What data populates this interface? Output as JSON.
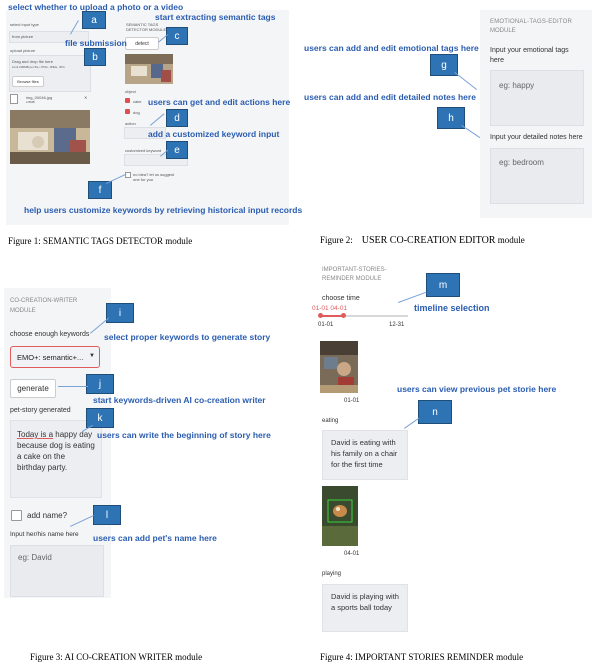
{
  "fig1": {
    "caption": "Figure 1: SEMANTIC TAGS DETECTOR module",
    "select_input_type_label": "select input type",
    "input_type_value": "from picture",
    "upload_picture_label": "upload picture",
    "drop_text": "Drag and drop file here",
    "limit_text": "Limit 200MB per file • PNG, JPEG, JPG",
    "browse_label": "Browse files",
    "file_name": "img_00046.jpg",
    "file_size": "2.8MB",
    "module_title": "SEMANTIC TAGS DETECTOR MODULE",
    "detect_button": "detect",
    "object_label": "object",
    "tag1": "cake",
    "tag2": "dog",
    "action_label": "action",
    "custom_keyword_label": "customized keyword",
    "no_idea_text": "no idea? let us suggest one for you",
    "annotations": {
      "a_text": "select whether to upload a photo or a video",
      "b_text": "file submission",
      "c_text": "start extracting semantic tags",
      "d_text": "users can get and edit actions here",
      "e_text": "add a customized keyword input",
      "f_text": "help users customize keywords by retrieving historical input records"
    },
    "letters": {
      "a": "a",
      "b": "b",
      "c": "c",
      "d": "d",
      "e": "e",
      "f": "f"
    }
  },
  "fig2": {
    "caption_prefix": "Figure 2:",
    "caption_main": "USER CO-CREATION EDITOR",
    "caption_suffix": "module",
    "module_title_1": "EMOTIONAL-TAGS-EDITOR",
    "module_title_2": "MODULE",
    "emotional_label_1": "Input your emotional tags",
    "emotional_label_2": "here",
    "emotional_placeholder": "eg: happy",
    "notes_label": "Input your detailed notes here",
    "notes_placeholder": "eg: bedroom",
    "annotations": {
      "g_text": "users can add and edit emotional tags here",
      "h_text": "users can add and edit detailed notes here"
    },
    "letters": {
      "g": "g",
      "h": "h"
    }
  },
  "fig3": {
    "caption": "Figure 3: AI CO-CREATION WRITER module",
    "module_title_1": "CO-CREATION-WRITER",
    "module_title_2": "MODULE",
    "keywords_label": "choose enough keywords",
    "select_value": "EMO+: semantic+...",
    "generate_button": "generate",
    "story_label": "pet-story generated",
    "story_text_underlined": "Today is a",
    "story_text": "happy day because dog is eating a cake on the birthday party.",
    "add_name_label": "add name?",
    "name_label": "Input her/his name here",
    "name_placeholder": "eg: David",
    "annotations": {
      "i_text": "select proper keywords to generate story",
      "j_text": "start keywords-driven AI co-creation writer",
      "k_text": "users can write the beginning of story here",
      "l_text": "users can add pet's name here"
    },
    "letters": {
      "i": "i",
      "j": "j",
      "k": "k",
      "l": "l"
    }
  },
  "fig4": {
    "caption": "Figure 4: IMPORTANT STORIES REMINDER module",
    "module_title_1": "IMPORTANT-STORIES-",
    "module_title_2": "REMINDER MODULE",
    "choose_time_label": "choose time",
    "selected_range": "01-01 04-01",
    "slider_min": "01-01",
    "slider_max": "12-31",
    "photo1_date": "01-01",
    "photo1_label": "eating",
    "story1": "David is eating with his family on a chair for the first time",
    "photo2_date": "04-01",
    "photo2_label": "playing",
    "story2": "David is playing with a sports ball today",
    "annotations": {
      "m_text": "timeline selection",
      "n_text": "users can view previous pet storie here"
    },
    "letters": {
      "m": "m",
      "n": "n"
    }
  }
}
